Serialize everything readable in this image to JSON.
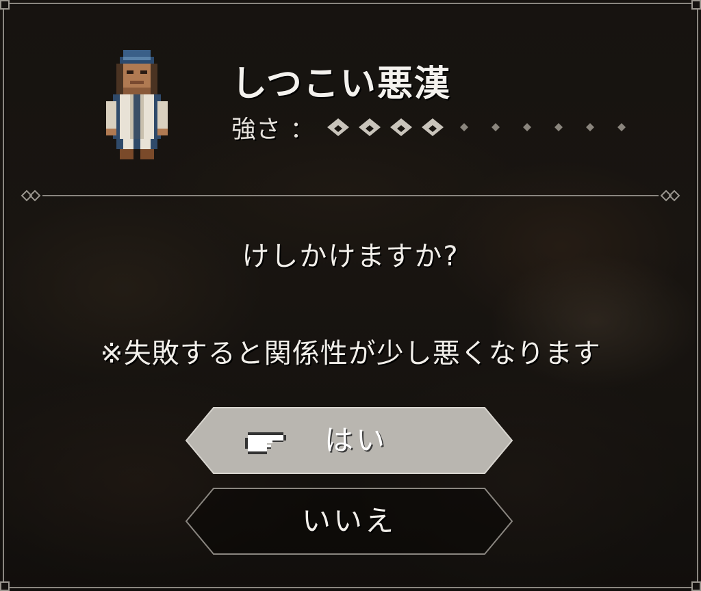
{
  "enemy": {
    "name": "しつこい悪漢",
    "strength_label": "強さ",
    "strength_separator": "：",
    "strength_level": 4,
    "strength_max": 10
  },
  "prompt": "けしかけますか?",
  "warning": "※失敗すると関係性が少し悪くなります",
  "choices": {
    "yes": "はい",
    "no": "いいえ",
    "selected": "yes"
  },
  "colors": {
    "pip_filled": "#c9c4bb",
    "pip_empty": "#8a857d",
    "panel_border": "#8a8680",
    "selected_button": "#b9b6b0"
  }
}
